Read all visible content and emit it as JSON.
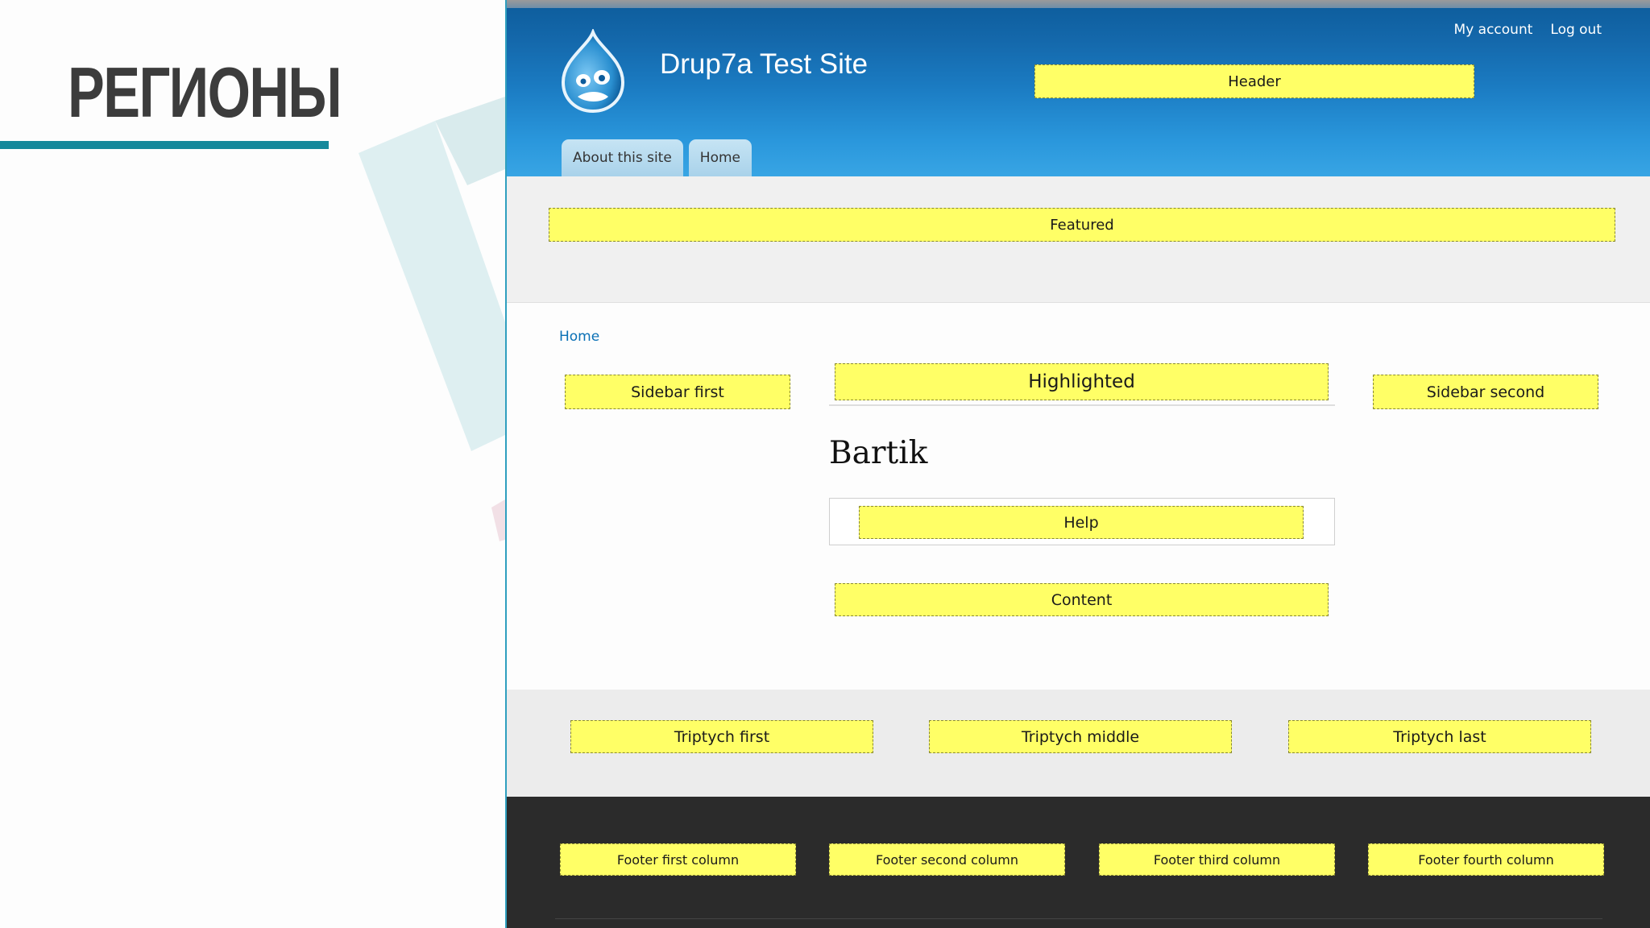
{
  "slide": {
    "title": "РЕГИОНЫ",
    "accent_color": "#15889b"
  },
  "site": {
    "name": "Drup7a Test Site",
    "logo_icon": "drupal-drop-icon",
    "secondary_menu": [
      "My account",
      "Log out"
    ],
    "main_menu": [
      "About this site",
      "Home"
    ],
    "breadcrumb": "Home",
    "page_title": "Bartik",
    "header_gradient": [
      "#0d5c9b",
      "#38a5e4"
    ],
    "region_color": "#ffff66",
    "regions": {
      "header": "Header",
      "featured": "Featured",
      "sidebar_first": "Sidebar first",
      "highlighted": "Highlighted",
      "sidebar_second": "Sidebar second",
      "help": "Help",
      "content": "Content",
      "triptych_first": "Triptych first",
      "triptych_middle": "Triptych middle",
      "triptych_last": "Triptych last",
      "footer_first": "Footer first column",
      "footer_second": "Footer second column",
      "footer_third": "Footer third column",
      "footer_fourth": "Footer fourth column"
    }
  }
}
